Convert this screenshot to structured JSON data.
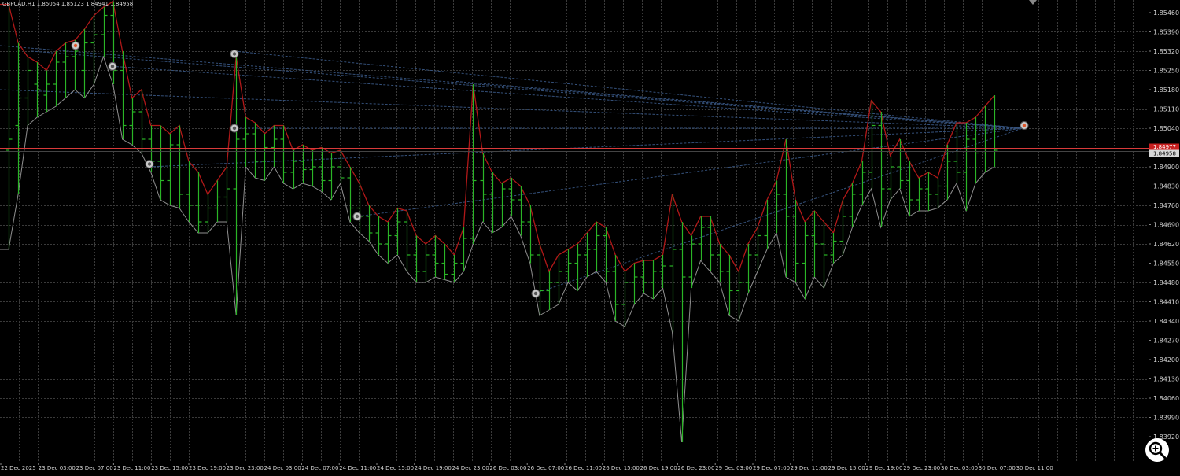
{
  "window": {
    "symbol_header": "GBPCAD,H1",
    "ohlc_header": "1.85054 1.85123 1.84941 1.84958"
  },
  "colors": {
    "background": "#000000",
    "grid": "#3a3a3a",
    "candle": "#2ab526",
    "upper_line": "#b01818",
    "lower_line": "#8f8f8f",
    "price_line": "#d83a3a",
    "price_tag": "#c82020",
    "trend_lines": "#34507a",
    "axis_text": "#d0d0d0",
    "markers": "#c8c8c8",
    "orange_marker": "#e0562a"
  },
  "icons": [
    "zoom-in-icon",
    "chart-shift-marker-icon",
    "fractal-marker-icon"
  ],
  "price_axis": {
    "labels": [
      "1.85460",
      "1.85390",
      "1.85320",
      "1.85250",
      "1.85180",
      "1.85110",
      "1.85040",
      "1.84900",
      "1.84830",
      "1.84760",
      "1.84690",
      "1.84620",
      "1.84550",
      "1.84480",
      "1.84410",
      "1.84340",
      "1.84270",
      "1.84200",
      "1.84130",
      "1.84060",
      "1.83990",
      "1.83920"
    ],
    "current_price_label": "1.84958",
    "price_tag_label": "1.84977"
  },
  "time_axis": {
    "labels": [
      "22 Dec 2025",
      "23 Dec 03:00",
      "23 Dec 07:00",
      "23 Dec 11:00",
      "23 Dec 15:00",
      "23 Dec 19:00",
      "23 Dec 23:00",
      "24 Dec 03:00",
      "24 Dec 07:00",
      "24 Dec 11:00",
      "24 Dec 15:00",
      "24 Dec 19:00",
      "24 Dec 23:00",
      "26 Dec 03:00",
      "26 Dec 07:00",
      "26 Dec 11:00",
      "26 Dec 15:00",
      "26 Dec 19:00",
      "26 Dec 23:00",
      "29 Dec 03:00",
      "29 Dec 07:00",
      "29 Dec 11:00",
      "29 Dec 15:00",
      "29 Dec 19:00",
      "29 Dec 23:00",
      "30 Dec 03:00",
      "30 Dec 07:00",
      "30 Dec 11:00"
    ]
  },
  "chart_data": {
    "type": "ohlc",
    "title": "GBPCAD,H1",
    "ylim": [
      1.839,
      1.8549
    ],
    "bars": [
      [
        1.8496,
        1.8549,
        1.846,
        1.85
      ],
      [
        1.8505,
        1.8535,
        1.848,
        1.8515
      ],
      [
        1.8515,
        1.853,
        1.8505,
        1.8525
      ],
      [
        1.852,
        1.8528,
        1.8508,
        1.8518
      ],
      [
        1.8516,
        1.8525,
        1.851,
        1.852
      ],
      [
        1.852,
        1.8532,
        1.8512,
        1.8528
      ],
      [
        1.8528,
        1.8535,
        1.8515,
        1.853
      ],
      [
        1.853,
        1.8536,
        1.8518,
        1.8532
      ],
      [
        1.8525,
        1.854,
        1.8515,
        1.8535
      ],
      [
        1.8535,
        1.8545,
        1.852,
        1.8538
      ],
      [
        1.8538,
        1.8548,
        1.853,
        1.8545
      ],
      [
        1.8545,
        1.855,
        1.852,
        1.8525
      ],
      [
        1.8525,
        1.8532,
        1.85,
        1.8505
      ],
      [
        1.8505,
        1.8515,
        1.8498,
        1.851
      ],
      [
        1.851,
        1.8518,
        1.8495,
        1.85
      ],
      [
        1.85,
        1.8505,
        1.8488,
        1.8492
      ],
      [
        1.8492,
        1.8505,
        1.8478,
        1.8485
      ],
      [
        1.8485,
        1.8502,
        1.8476,
        1.8498
      ],
      [
        1.8498,
        1.8505,
        1.8475,
        1.848
      ],
      [
        1.848,
        1.8492,
        1.847,
        1.8476
      ],
      [
        1.8476,
        1.8488,
        1.8466,
        1.847
      ],
      [
        1.847,
        1.848,
        1.8466,
        1.8475
      ],
      [
        1.8475,
        1.8485,
        1.847,
        1.8479
      ],
      [
        1.8479,
        1.849,
        1.847,
        1.8482
      ],
      [
        1.8482,
        1.853,
        1.8436,
        1.85
      ],
      [
        1.85,
        1.8508,
        1.849,
        1.8502
      ],
      [
        1.8502,
        1.8506,
        1.8486,
        1.8492
      ],
      [
        1.8492,
        1.8502,
        1.8485,
        1.8497
      ],
      [
        1.8497,
        1.8505,
        1.849,
        1.85
      ],
      [
        1.85,
        1.8505,
        1.8484,
        1.8488
      ],
      [
        1.8488,
        1.8496,
        1.8482,
        1.8492
      ],
      [
        1.8492,
        1.8498,
        1.8484,
        1.8489
      ],
      [
        1.8489,
        1.8496,
        1.8483,
        1.849
      ],
      [
        1.849,
        1.8497,
        1.8481,
        1.8485
      ],
      [
        1.8485,
        1.8495,
        1.8478,
        1.849
      ],
      [
        1.849,
        1.8496,
        1.8484,
        1.8486
      ],
      [
        1.8486,
        1.849,
        1.847,
        1.8475
      ],
      [
        1.8475,
        1.8484,
        1.8466,
        1.8472
      ],
      [
        1.8472,
        1.8476,
        1.8463,
        1.8466
      ],
      [
        1.8466,
        1.8472,
        1.8458,
        1.8462
      ],
      [
        1.8462,
        1.847,
        1.8455,
        1.8465
      ],
      [
        1.8465,
        1.8475,
        1.8458,
        1.847
      ],
      [
        1.847,
        1.8474,
        1.8452,
        1.8458
      ],
      [
        1.8458,
        1.8465,
        1.8448,
        1.8452
      ],
      [
        1.8452,
        1.8462,
        1.8448,
        1.8458
      ],
      [
        1.8458,
        1.8465,
        1.845,
        1.8455
      ],
      [
        1.8455,
        1.8462,
        1.8449,
        1.8451
      ],
      [
        1.8451,
        1.8458,
        1.8448,
        1.8455
      ],
      [
        1.8455,
        1.8468,
        1.8452,
        1.8464
      ],
      [
        1.8464,
        1.852,
        1.8462,
        1.8485
      ],
      [
        1.8485,
        1.8495,
        1.847,
        1.848
      ],
      [
        1.848,
        1.8488,
        1.8466,
        1.8475
      ],
      [
        1.8475,
        1.8484,
        1.8468,
        1.8482
      ],
      [
        1.8482,
        1.8486,
        1.8472,
        1.8478
      ],
      [
        1.8478,
        1.8483,
        1.8465,
        1.847
      ],
      [
        1.847,
        1.8476,
        1.8455,
        1.8458
      ],
      [
        1.8458,
        1.8462,
        1.8436,
        1.8445
      ],
      [
        1.8445,
        1.8452,
        1.8438,
        1.8448
      ],
      [
        1.8448,
        1.8458,
        1.844,
        1.8452
      ],
      [
        1.8452,
        1.846,
        1.8448,
        1.8455
      ],
      [
        1.8455,
        1.8462,
        1.8445,
        1.8458
      ],
      [
        1.8458,
        1.8466,
        1.845,
        1.846
      ],
      [
        1.846,
        1.847,
        1.8452,
        1.8465
      ],
      [
        1.8465,
        1.8468,
        1.8448,
        1.8452
      ],
      [
        1.8452,
        1.8458,
        1.8434,
        1.844
      ],
      [
        1.844,
        1.8452,
        1.8432,
        1.8448
      ],
      [
        1.8448,
        1.8455,
        1.844,
        1.845
      ],
      [
        1.845,
        1.8456,
        1.8444,
        1.8448
      ],
      [
        1.8448,
        1.8456,
        1.8442,
        1.8452
      ],
      [
        1.8452,
        1.8458,
        1.8446,
        1.8454
      ],
      [
        1.8454,
        1.848,
        1.843,
        1.846
      ],
      [
        1.846,
        1.847,
        1.839,
        1.845
      ],
      [
        1.845,
        1.8465,
        1.8446,
        1.8462
      ],
      [
        1.8462,
        1.8472,
        1.8456,
        1.8468
      ],
      [
        1.8468,
        1.8472,
        1.8452,
        1.8458
      ],
      [
        1.8458,
        1.8462,
        1.8448,
        1.8452
      ],
      [
        1.8452,
        1.8458,
        1.8436,
        1.8445
      ],
      [
        1.8445,
        1.8452,
        1.8434,
        1.8448
      ],
      [
        1.8448,
        1.8462,
        1.8444,
        1.8458
      ],
      [
        1.8458,
        1.8468,
        1.8452,
        1.8465
      ],
      [
        1.8465,
        1.8478,
        1.846,
        1.8475
      ],
      [
        1.8475,
        1.8485,
        1.8466,
        1.848
      ],
      [
        1.848,
        1.85,
        1.845,
        1.8472
      ],
      [
        1.8472,
        1.8478,
        1.8448,
        1.8455
      ],
      [
        1.8455,
        1.847,
        1.8442,
        1.8465
      ],
      [
        1.8465,
        1.8474,
        1.845,
        1.8462
      ],
      [
        1.8462,
        1.847,
        1.8446,
        1.8458
      ],
      [
        1.8458,
        1.8466,
        1.8455,
        1.8463
      ],
      [
        1.8463,
        1.8478,
        1.8458,
        1.8472
      ],
      [
        1.8472,
        1.8484,
        1.8468,
        1.848
      ],
      [
        1.848,
        1.8492,
        1.8476,
        1.8488
      ],
      [
        1.8488,
        1.8514,
        1.8482,
        1.8505
      ],
      [
        1.8505,
        1.851,
        1.8468,
        1.8482
      ],
      [
        1.8482,
        1.8494,
        1.8478,
        1.849
      ],
      [
        1.849,
        1.85,
        1.8482,
        1.8485
      ],
      [
        1.8485,
        1.8492,
        1.8472,
        1.8478
      ],
      [
        1.8478,
        1.8486,
        1.8474,
        1.8482
      ],
      [
        1.8482,
        1.8488,
        1.8474,
        1.848
      ],
      [
        1.848,
        1.8486,
        1.8475,
        1.8483
      ],
      [
        1.8483,
        1.8498,
        1.8478,
        1.8492
      ],
      [
        1.8492,
        1.8506,
        1.8484,
        1.8488
      ],
      [
        1.8488,
        1.8506,
        1.8474,
        1.85
      ],
      [
        1.85,
        1.8508,
        1.8484,
        1.8495
      ],
      [
        1.8495,
        1.8512,
        1.8488,
        1.8503
      ],
      [
        1.8503,
        1.8516,
        1.849,
        1.8496
      ]
    ]
  }
}
